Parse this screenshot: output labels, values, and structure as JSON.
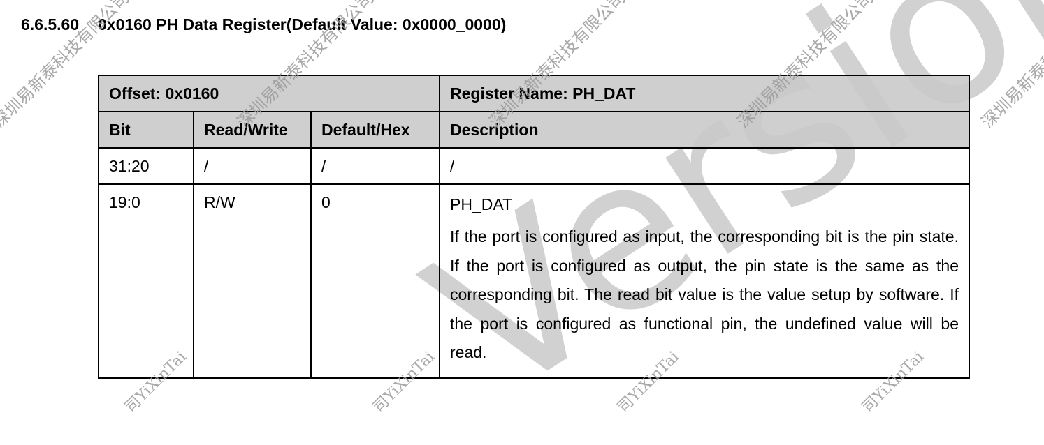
{
  "section": {
    "number": "6.6.5.60",
    "title": "0x0160 PH Data Register(Default Value: 0x0000_0000)"
  },
  "register": {
    "offset_label": "Offset: 0x0160",
    "name_label": "Register Name: PH_DAT"
  },
  "columns": [
    "Bit",
    "Read/Write",
    "Default/Hex",
    "Description"
  ],
  "rows": [
    {
      "bit": "31:20",
      "rw": "/",
      "default": "/",
      "desc_name": "/",
      "desc_text": ""
    },
    {
      "bit": "19:0",
      "rw": "R/W",
      "default": "0",
      "desc_name": "PH_DAT",
      "desc_text": "If the port is configured as input, the corresponding bit is the pin state. If the port is configured as output, the pin state is the same as the corresponding bit. The read bit value is the value setup by software. If the port is configured as functional pin, the undefined value will be read."
    }
  ],
  "watermarks": {
    "cn": "深圳易新泰科技有限公司",
    "en": "司YiXinTai",
    "big": "Version"
  }
}
